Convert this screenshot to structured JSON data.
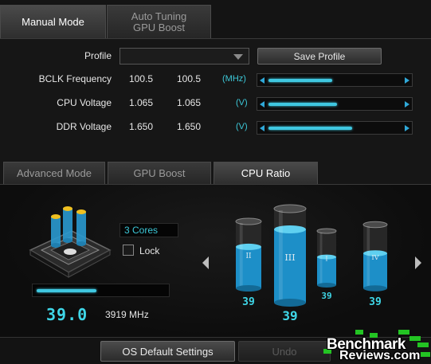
{
  "tabs_top": [
    {
      "label": "Manual Mode",
      "active": true
    },
    {
      "label": "Auto Tuning\nGPU Boost",
      "active": false
    }
  ],
  "profile": {
    "label": "Profile",
    "selected": "",
    "save_label": "Save Profile"
  },
  "settings": [
    {
      "label": "BCLK Frequency",
      "current": "100.5",
      "target": "100.5",
      "unit": "(MHz)",
      "level": 0.48
    },
    {
      "label": "CPU Voltage",
      "current": "1.065",
      "target": "1.065",
      "unit": "(V)",
      "level": 0.52
    },
    {
      "label": "DDR Voltage",
      "current": "1.650",
      "target": "1.650",
      "unit": "(V)",
      "level": 0.63
    }
  ],
  "tabs_lower": [
    {
      "label": "Advanced Mode",
      "active": false
    },
    {
      "label": "GPU Boost",
      "active": false
    },
    {
      "label": "CPU Ratio",
      "active": true
    }
  ],
  "cpu_ratio": {
    "cores_option": "3 Cores",
    "lock_label": "Lock",
    "lock_checked": false,
    "ratio_value": "39.0",
    "frequency": "3919 MHz",
    "ratio_level": 0.5
  },
  "cores": [
    {
      "roman": "II",
      "value": "39",
      "fill": 0.62
    },
    {
      "roman": "III",
      "value": "39",
      "fill": 0.78
    },
    {
      "roman": "I",
      "value": "39",
      "fill": 0.52
    },
    {
      "roman": "IV",
      "value": "39",
      "fill": 0.55
    }
  ],
  "buttons": {
    "os_default": "OS Default Settings",
    "undo": "Undo"
  },
  "watermark": {
    "line1": "Benchmark",
    "line2": "Reviews.com"
  },
  "colors": {
    "accent": "#3fc7e0",
    "value_text": "#3fd7e8",
    "watermark_green": "#23c423"
  }
}
